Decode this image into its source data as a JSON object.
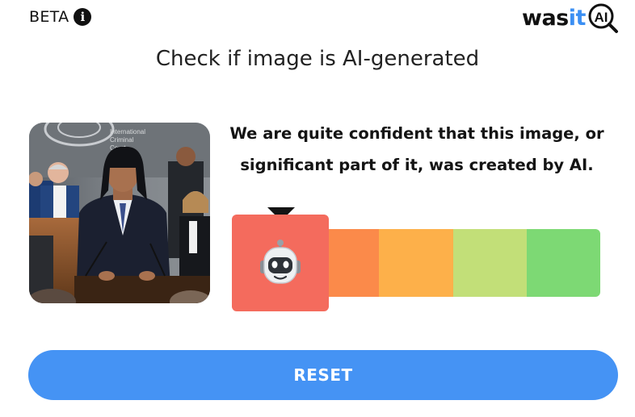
{
  "header": {
    "beta_label": "BETA",
    "info_icon": "info-icon",
    "logo": {
      "part1": "was",
      "part2": "it",
      "badge": "AI"
    }
  },
  "title": "Check if image is AI-generated",
  "result": {
    "line1": "We are quite confident that this image, or",
    "line2": "significant part of it, was created by AI.",
    "meter": {
      "segment_colors": [
        "#f46b5d",
        "#fb8a4a",
        "#fdb04a",
        "#c2df78",
        "#7dd974"
      ],
      "level_index": 0,
      "indicator_icon": "robot-face-icon"
    }
  },
  "actions": {
    "reset_label": "RESET"
  },
  "photo": {
    "alt": "courtroom-photo",
    "wall_text": [
      "International",
      "Criminal",
      "Court"
    ]
  }
}
